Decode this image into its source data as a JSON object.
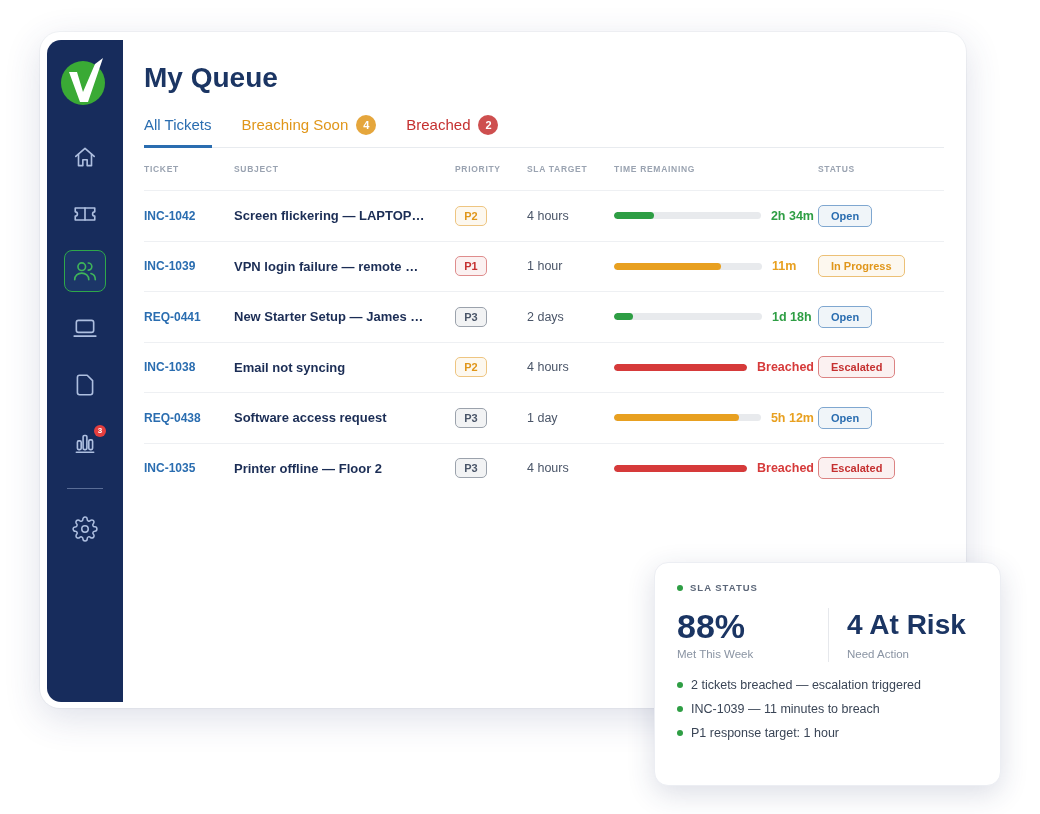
{
  "sidebar": {
    "items": [
      {
        "selected": false
      },
      {
        "selected": false
      },
      {
        "selected": true
      },
      {
        "selected": false
      },
      {
        "selected": false
      },
      {
        "selected": false,
        "badge": "3"
      }
    ],
    "settings": {
      "selected": false
    }
  },
  "title": "My Queue",
  "tabs": [
    {
      "label": "All Tickets",
      "selected": true,
      "color": "#2a6db0"
    },
    {
      "label": "Breaching Soon",
      "selected": false,
      "color": "#e0961a",
      "count": "4"
    },
    {
      "label": "Breached",
      "selected": false,
      "color": "#c53030",
      "count": "2"
    }
  ],
  "table": {
    "columns": [
      "TICKET",
      "SUBJECT",
      "PRIORITY",
      "SLA TARGET",
      "TIME REMAINING",
      "STATUS"
    ],
    "rows": [
      {
        "ticket": "INC-1042",
        "subject": "Screen flickering — LAPTOP…",
        "priority": {
          "label": "P2",
          "color": "#e0961a"
        },
        "sla_target": "4 hours",
        "time_remaining": {
          "value": "2h 34m",
          "level": 0.27,
          "color": "#2e9e44"
        },
        "status": {
          "label": "Open",
          "color": "#2a6db0"
        }
      },
      {
        "ticket": "INC-1039",
        "subject": "VPN login failure — remote …",
        "priority": {
          "label": "P1",
          "color": "#c53030"
        },
        "sla_target": "1 hour",
        "time_remaining": {
          "value": "11m",
          "level": 0.72,
          "color": "#e8a020"
        },
        "status": {
          "label": "In Progress",
          "color": "#e0961a"
        }
      },
      {
        "ticket": "REQ-0441",
        "subject": "New Starter Setup — James …",
        "priority": {
          "label": "P3",
          "color": "#4a5568"
        },
        "sla_target": "2 days",
        "time_remaining": {
          "value": "1d 18h",
          "level": 0.13,
          "color": "#2e9e44"
        },
        "status": {
          "label": "Open",
          "color": "#2a6db0"
        }
      },
      {
        "ticket": "INC-1038",
        "subject": "Email not syncing",
        "priority": {
          "label": "P2",
          "color": "#e0961a"
        },
        "sla_target": "4 hours",
        "time_remaining": {
          "value": "Breached",
          "level": 1,
          "color": "#d63a3a"
        },
        "status": {
          "label": "Escalated",
          "color": "#c53030"
        }
      },
      {
        "ticket": "REQ-0438",
        "subject": "Software access request",
        "priority": {
          "label": "P3",
          "color": "#4a5568"
        },
        "sla_target": "1 day",
        "time_remaining": {
          "value": "5h 12m",
          "level": 0.85,
          "color": "#e8a020"
        },
        "status": {
          "label": "Open",
          "color": "#2a6db0"
        }
      },
      {
        "ticket": "INC-1035",
        "subject": "Printer offline — Floor 2",
        "priority": {
          "label": "P3",
          "color": "#4a5568"
        },
        "sla_target": "4 hours",
        "time_remaining": {
          "value": "Breached",
          "level": 1,
          "color": "#d63a3a"
        },
        "status": {
          "label": "Escalated",
          "color": "#c53030"
        }
      }
    ]
  },
  "sla_card": {
    "title": "SLA STATUS",
    "stats": [
      {
        "value": "88%",
        "label": "Met This Week"
      },
      {
        "value": "4 At Risk",
        "label": "Need Action"
      }
    ],
    "notes": [
      "2 tickets breached — escalation triggered",
      "INC-1039 — 11 minutes to breach",
      "P1 response target: 1 hour"
    ]
  }
}
